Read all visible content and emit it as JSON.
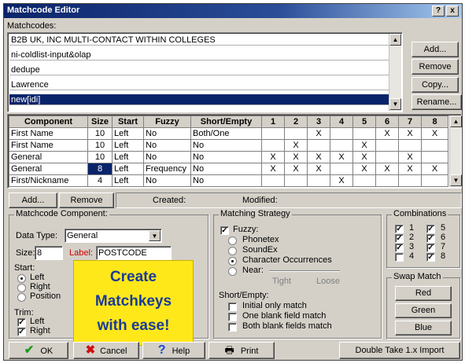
{
  "window": {
    "title": "Matchcode Editor",
    "help_btn": "?",
    "close_btn": "x"
  },
  "matchcodes": {
    "label": "Matchcodes:",
    "items": [
      "B2B UK, INC MULTI-CONTACT WITHIN COLLEGES",
      "ni-coldlist-input&olap",
      "dedupe",
      "Lawrence",
      "new[idi]"
    ],
    "selected_index": 4,
    "buttons": {
      "add": "Add...",
      "remove": "Remove",
      "copy": "Copy...",
      "rename": "Rename..."
    }
  },
  "grid": {
    "headers": [
      "Component",
      "Size",
      "Start",
      "Fuzzy",
      "Short/Empty",
      "1",
      "2",
      "3",
      "4",
      "5",
      "6",
      "7",
      "8"
    ],
    "rows": [
      {
        "component": "First Name",
        "size": "10",
        "start": "Left",
        "fuzzy": "No",
        "short_empty": "Both/One",
        "marks": [
          "",
          "",
          "X",
          "",
          "",
          "X",
          "X",
          "X"
        ]
      },
      {
        "component": "First Name",
        "size": "10",
        "start": "Left",
        "fuzzy": "No",
        "short_empty": "No",
        "marks": [
          "",
          "X",
          "",
          "",
          "X",
          "",
          "",
          ""
        ]
      },
      {
        "component": "General",
        "size": "10",
        "start": "Left",
        "fuzzy": "No",
        "short_empty": "No",
        "marks": [
          "X",
          "X",
          "X",
          "X",
          "X",
          "",
          "X",
          ""
        ]
      },
      {
        "component": "General",
        "size": "8",
        "start": "Left",
        "fuzzy": "Frequency",
        "short_empty": "No",
        "marks": [
          "X",
          "X",
          "X",
          "",
          "X",
          "X",
          "X",
          "X"
        ]
      },
      {
        "component": "First/Nickname",
        "size": "4",
        "start": "Left",
        "fuzzy": "No",
        "short_empty": "No",
        "marks": [
          "",
          "",
          "",
          "X",
          "",
          "",
          "",
          ""
        ]
      }
    ]
  },
  "grid_actions": {
    "add": "Add...",
    "remove": "Remove",
    "created": "Created:",
    "modified": "Modified:"
  },
  "component": {
    "title": "Matchcode Component:",
    "data_type_label": "Data Type:",
    "data_type_value": "General",
    "size_label": "Size:",
    "size_value": "8",
    "label_label": "Label:",
    "label_value": "POSTCODE",
    "start_label": "Start:",
    "start_options": [
      "Left",
      "Right",
      "Position"
    ],
    "start_selected": 0,
    "trim_label": "Trim:",
    "trim_options": [
      "Left",
      "Right"
    ]
  },
  "promo": {
    "line1": "Create",
    "line2": "Matchkeys",
    "line3": "with ease!"
  },
  "strategy": {
    "title": "Matching Strategy",
    "fuzzy_label": "Fuzzy:",
    "options": [
      "Phonetex",
      "SoundEx",
      "Character Occurrences",
      "Near:"
    ],
    "selected": 2,
    "tight": "Tight",
    "loose": "Loose",
    "short_empty_label": "Short/Empty:",
    "short_options": [
      "Initial only match",
      "One blank field match",
      "Both blank fields match"
    ]
  },
  "combinations": {
    "title": "Combinations",
    "items": [
      "1",
      "2",
      "3",
      "4",
      "5",
      "6",
      "7",
      "8"
    ]
  },
  "swap": {
    "title": "Swap Match",
    "red": "Red",
    "green": "Green",
    "blue": "Blue"
  },
  "bottom": {
    "ok": "OK",
    "cancel": "Cancel",
    "help": "Help",
    "print": "Print",
    "import": "Double Take 1.x Import"
  },
  "colors": {
    "title_bar": "#0a246a",
    "selection": "#0a246a",
    "promo_bg": "#ffe81a",
    "promo_text": "#1a3a9a",
    "ok_check": "#1e9a1e",
    "cancel_x": "#cc1111",
    "help_q": "#1a4ad0"
  }
}
